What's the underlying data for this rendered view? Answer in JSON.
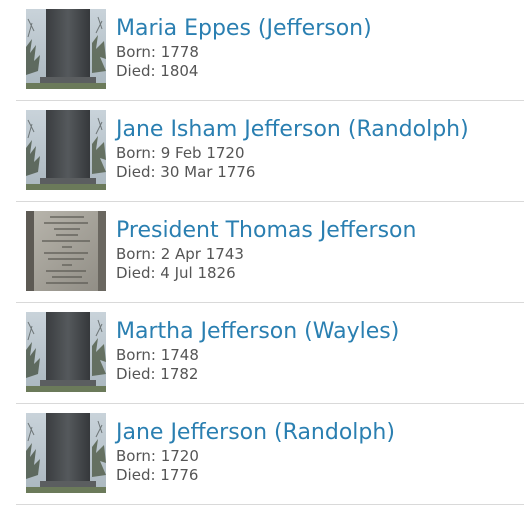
{
  "people": [
    {
      "name": "Maria Eppes (Jefferson)",
      "born": "Born: 1778",
      "died": "Died: 1804",
      "thumbnail": "obelisk-photo"
    },
    {
      "name": "Jane Isham Jefferson (Randolph)",
      "born": "Born: 9 Feb 1720",
      "died": "Died: 30 Mar 1776",
      "thumbnail": "obelisk-photo"
    },
    {
      "name": "President Thomas Jefferson",
      "born": "Born: 2 Apr 1743",
      "died": "Died: 4 Jul 1826",
      "thumbnail": "inscription-plaque-photo"
    },
    {
      "name": "Martha Jefferson (Wayles)",
      "born": "Born: 1748",
      "died": "Died: 1782",
      "thumbnail": "obelisk-photo"
    },
    {
      "name": "Jane Jefferson (Randolph)",
      "born": "Born: 1720",
      "died": "Died: 1776",
      "thumbnail": "obelisk-photo"
    }
  ],
  "colors": {
    "link": "#2a7fb1",
    "detail_text": "#555555",
    "divider": "#d9d9d9"
  }
}
